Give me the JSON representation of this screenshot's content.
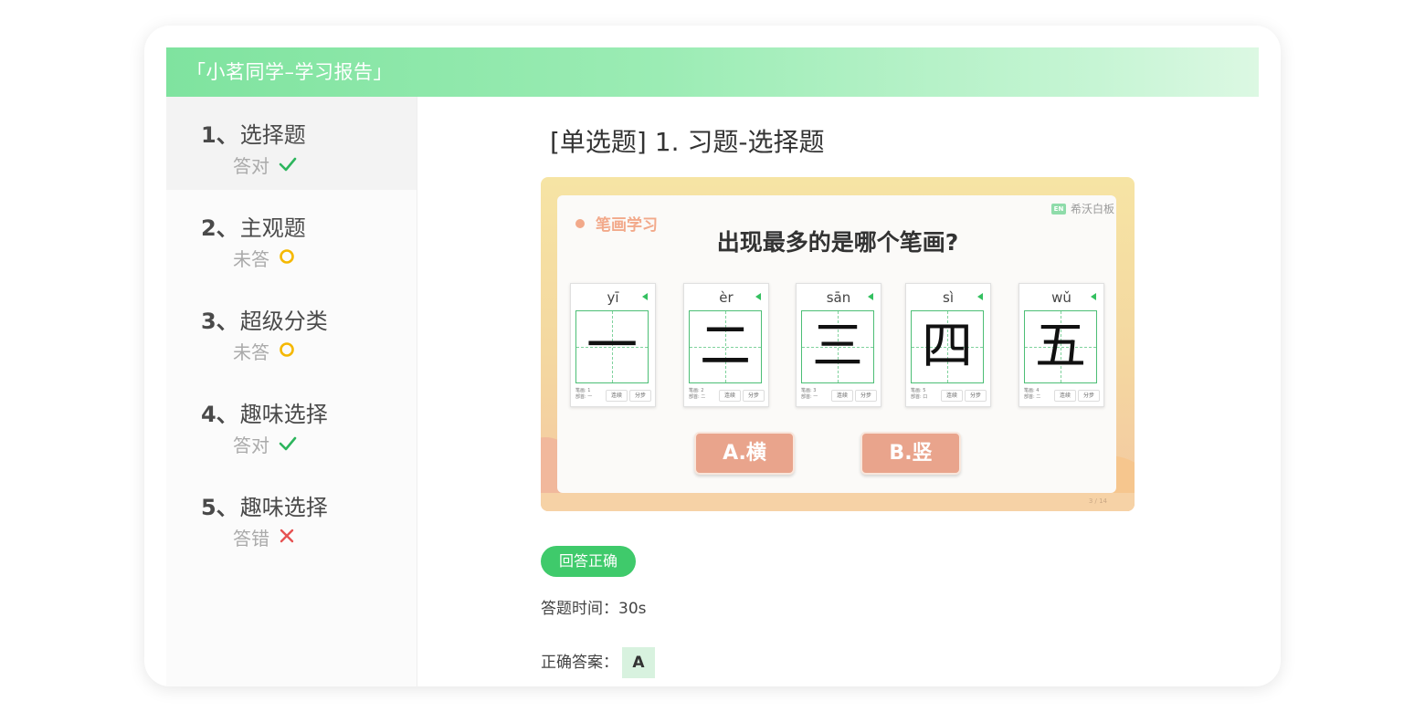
{
  "header": {
    "title": "「小茗同学–学习报告」"
  },
  "sidebar": {
    "items": [
      {
        "num": "1、",
        "label": "选择题",
        "status": "答对",
        "status_icon": "check-icon",
        "status_color": "#2db55d"
      },
      {
        "num": "2、",
        "label": "主观题",
        "status": "未答",
        "status_icon": "circle-icon",
        "status_color": "#f5b800"
      },
      {
        "num": "3、",
        "label": "超级分类",
        "status": "未答",
        "status_icon": "circle-icon",
        "status_color": "#f5b800"
      },
      {
        "num": "4、",
        "label": "趣味选择",
        "status": "答对",
        "status_icon": "check-icon",
        "status_color": "#2db55d"
      },
      {
        "num": "5、",
        "label": "趣味选择",
        "status": "答错",
        "status_icon": "cross-icon",
        "status_color": "#e65252"
      }
    ]
  },
  "main": {
    "question_title": "[单选题] 1. 习题-选择题",
    "slide": {
      "tag": "笔画学习",
      "brand": "希沃白板",
      "brand_logo": "EN",
      "question": "出现最多的是哪个笔画?",
      "cards": [
        {
          "pinyin": "yī",
          "char": "一",
          "meta": "笔画: 1\n部首: 一"
        },
        {
          "pinyin": "èr",
          "char": "二",
          "meta": "笔画: 2\n部首: 二"
        },
        {
          "pinyin": "sān",
          "char": "三",
          "meta": "笔画: 3\n部首: 一"
        },
        {
          "pinyin": "sì",
          "char": "四",
          "meta": "笔画: 5\n部首: 口"
        },
        {
          "pinyin": "wǔ",
          "char": "五",
          "meta": "笔画: 4\n部首: 二"
        }
      ],
      "card_btn_1": "连续",
      "card_btn_2": "分步",
      "options": [
        "A.横",
        "B.竖"
      ],
      "page_indicator": "3 / 14"
    },
    "result_badge": "回答正确",
    "time_label": "答题时间：",
    "time_value": "30s",
    "answer_label": "正确答案：",
    "answer_value": "A"
  },
  "colors": {
    "accent": "#3fca6b",
    "header": "#7fe39f",
    "option": "#e9a48c"
  }
}
